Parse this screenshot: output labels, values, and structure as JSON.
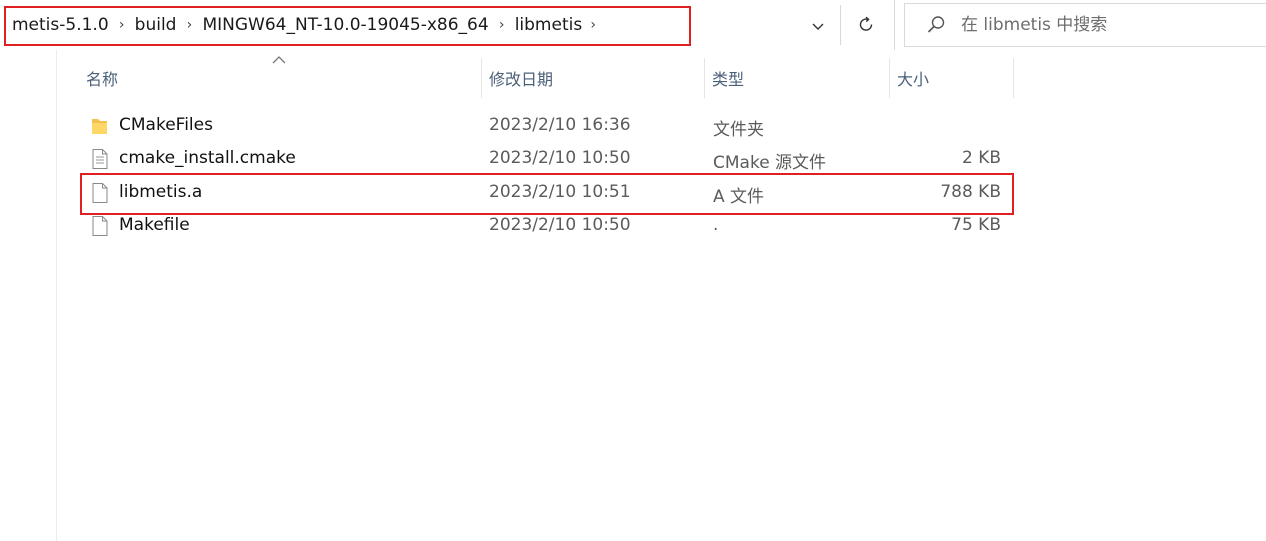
{
  "address_bar": {
    "breadcrumbs": [
      "metis-5.1.0",
      "build",
      "MINGW64_NT-10.0-19045-x86_64",
      "libmetis"
    ],
    "separator_icon": "chevron-right-icon",
    "dropdown_icon": "chevron-down-icon",
    "refresh_icon": "refresh-icon"
  },
  "search": {
    "placeholder": "在 libmetis 中搜索",
    "icon": "search-icon"
  },
  "columns": {
    "name": "名称",
    "date": "修改日期",
    "type": "类型",
    "size": "大小",
    "sort_icon": "sort-ascending-caret-icon"
  },
  "files": [
    {
      "name": "CMakeFiles",
      "date": "2023/2/10 16:36",
      "type": "文件夹",
      "size": "",
      "icon": "folder-icon"
    },
    {
      "name": "cmake_install.cmake",
      "date": "2023/2/10 10:50",
      "type": "CMake 源文件",
      "size": "2 KB",
      "icon": "text-file-icon"
    },
    {
      "name": "libmetis.a",
      "date": "2023/2/10 10:51",
      "type": "A 文件",
      "size": "788 KB",
      "icon": "file-icon"
    },
    {
      "name": "Makefile",
      "date": "2023/2/10 10:50",
      "type": ".",
      "size": "75 KB",
      "icon": "file-icon"
    }
  ],
  "colors": {
    "highlight": "#e02020",
    "header_text": "#4c607a",
    "folder": "#f2c14e"
  }
}
